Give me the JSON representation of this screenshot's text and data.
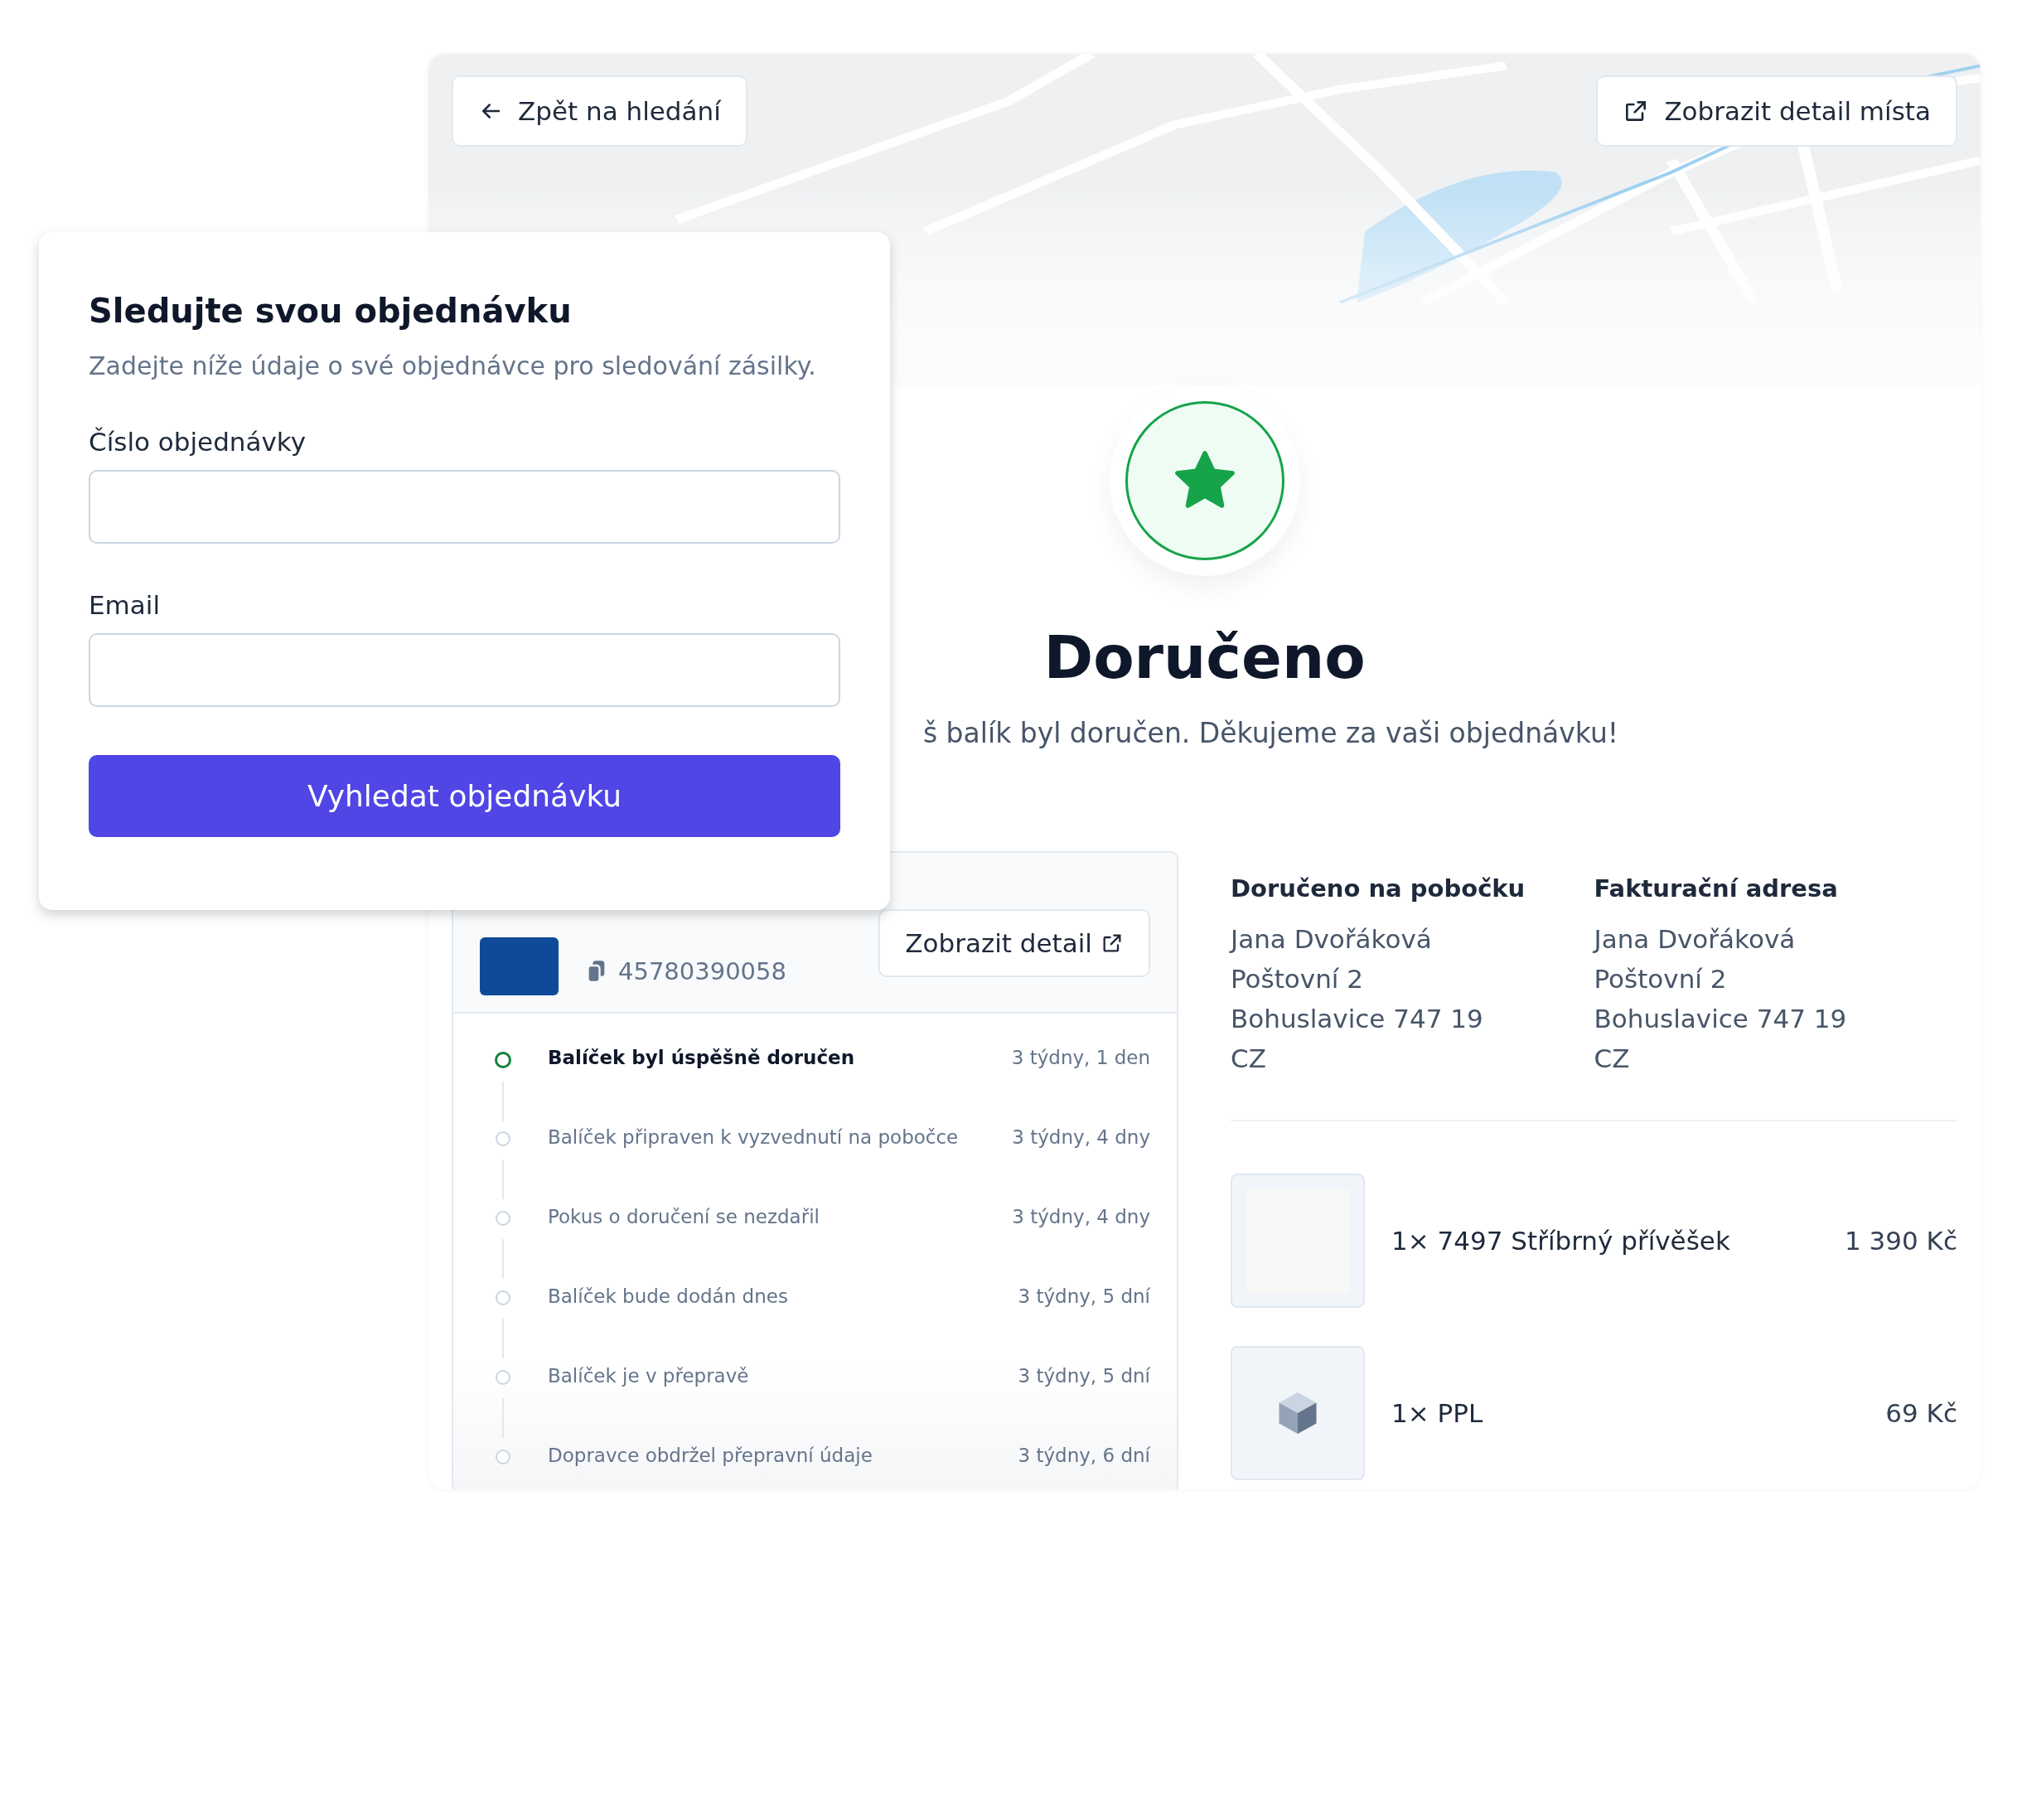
{
  "map": {
    "back_button": "Zpět na hledání",
    "detail_button": "Zobrazit detail místa"
  },
  "status": {
    "title": "Doručeno",
    "message": "š balík byl doručen. Děkujeme za vaši objednávku!"
  },
  "shipment": {
    "tracking_number": "45780390058",
    "detail_button": "Zobrazit detail",
    "events": [
      {
        "text": "Balíček byl úspěšně doručen",
        "time": "3 týdny, 1 den",
        "current": true
      },
      {
        "text": "Balíček připraven k vyzvednutí na pobočce",
        "time": "3 týdny, 4 dny",
        "current": false
      },
      {
        "text": "Pokus o doručení se nezdařil",
        "time": "3 týdny, 4 dny",
        "current": false
      },
      {
        "text": "Balíček bude dodán dnes",
        "time": "3 týdny, 5 dní",
        "current": false
      },
      {
        "text": "Balíček je v přepravě",
        "time": "3 týdny, 5 dní",
        "current": false
      },
      {
        "text": "Dopravce obdržel přepravní údaje",
        "time": "3 týdny, 6 dní",
        "current": false
      }
    ]
  },
  "addresses": [
    {
      "heading": "Doručeno na pobočku",
      "lines": [
        "Jana Dvořáková",
        "Poštovní 2",
        "Bohuslavice 747 19",
        "CZ"
      ]
    },
    {
      "heading": "Fakturační adresa",
      "lines": [
        "Jana Dvořáková",
        "Poštovní 2",
        "Bohuslavice 747 19",
        "CZ"
      ]
    }
  ],
  "items": [
    {
      "kind": "product",
      "name": "1× 7497 Stříbrný přívěšek",
      "price": "1 390 Kč"
    },
    {
      "kind": "shipping",
      "name": "1× PPL",
      "price": "69 Kč"
    }
  ],
  "tracking_form": {
    "title": "Sledujte svou objednávku",
    "subtitle": "Zadejte níže údaje o své objednávce pro sledování zásilky.",
    "fields": [
      {
        "label": "Číslo objednávky"
      },
      {
        "label": "Email"
      }
    ],
    "submit_button": "Vyhledat objednávku"
  }
}
